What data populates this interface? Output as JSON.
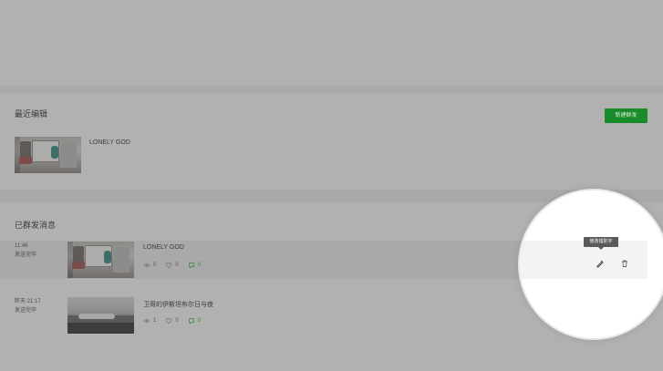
{
  "recent": {
    "title": "最近编辑",
    "new_button": "新建群发",
    "item": {
      "title": "LONELY GOD"
    }
  },
  "sent": {
    "title": "已群发消息",
    "items": [
      {
        "time": "11:46",
        "status": "发送完毕 ·",
        "title": "LONELY GOD",
        "views": "0",
        "likes": "0",
        "comments": "0"
      },
      {
        "time": "昨天 21:17",
        "status": "发送完毕 ·",
        "title": "卫哥的伊斯坦布尔日与夜",
        "views": "1",
        "likes": "0",
        "comments": "0"
      }
    ]
  },
  "tooltip": "修改错别字",
  "icons": {
    "edit": "edit-typo-icon",
    "delete": "trash-icon",
    "views": "eye-icon",
    "likes": "heart-icon",
    "comments": "comment-icon"
  },
  "colors": {
    "accent": "#1a8b2a",
    "overlay": "#b0b0b0"
  }
}
